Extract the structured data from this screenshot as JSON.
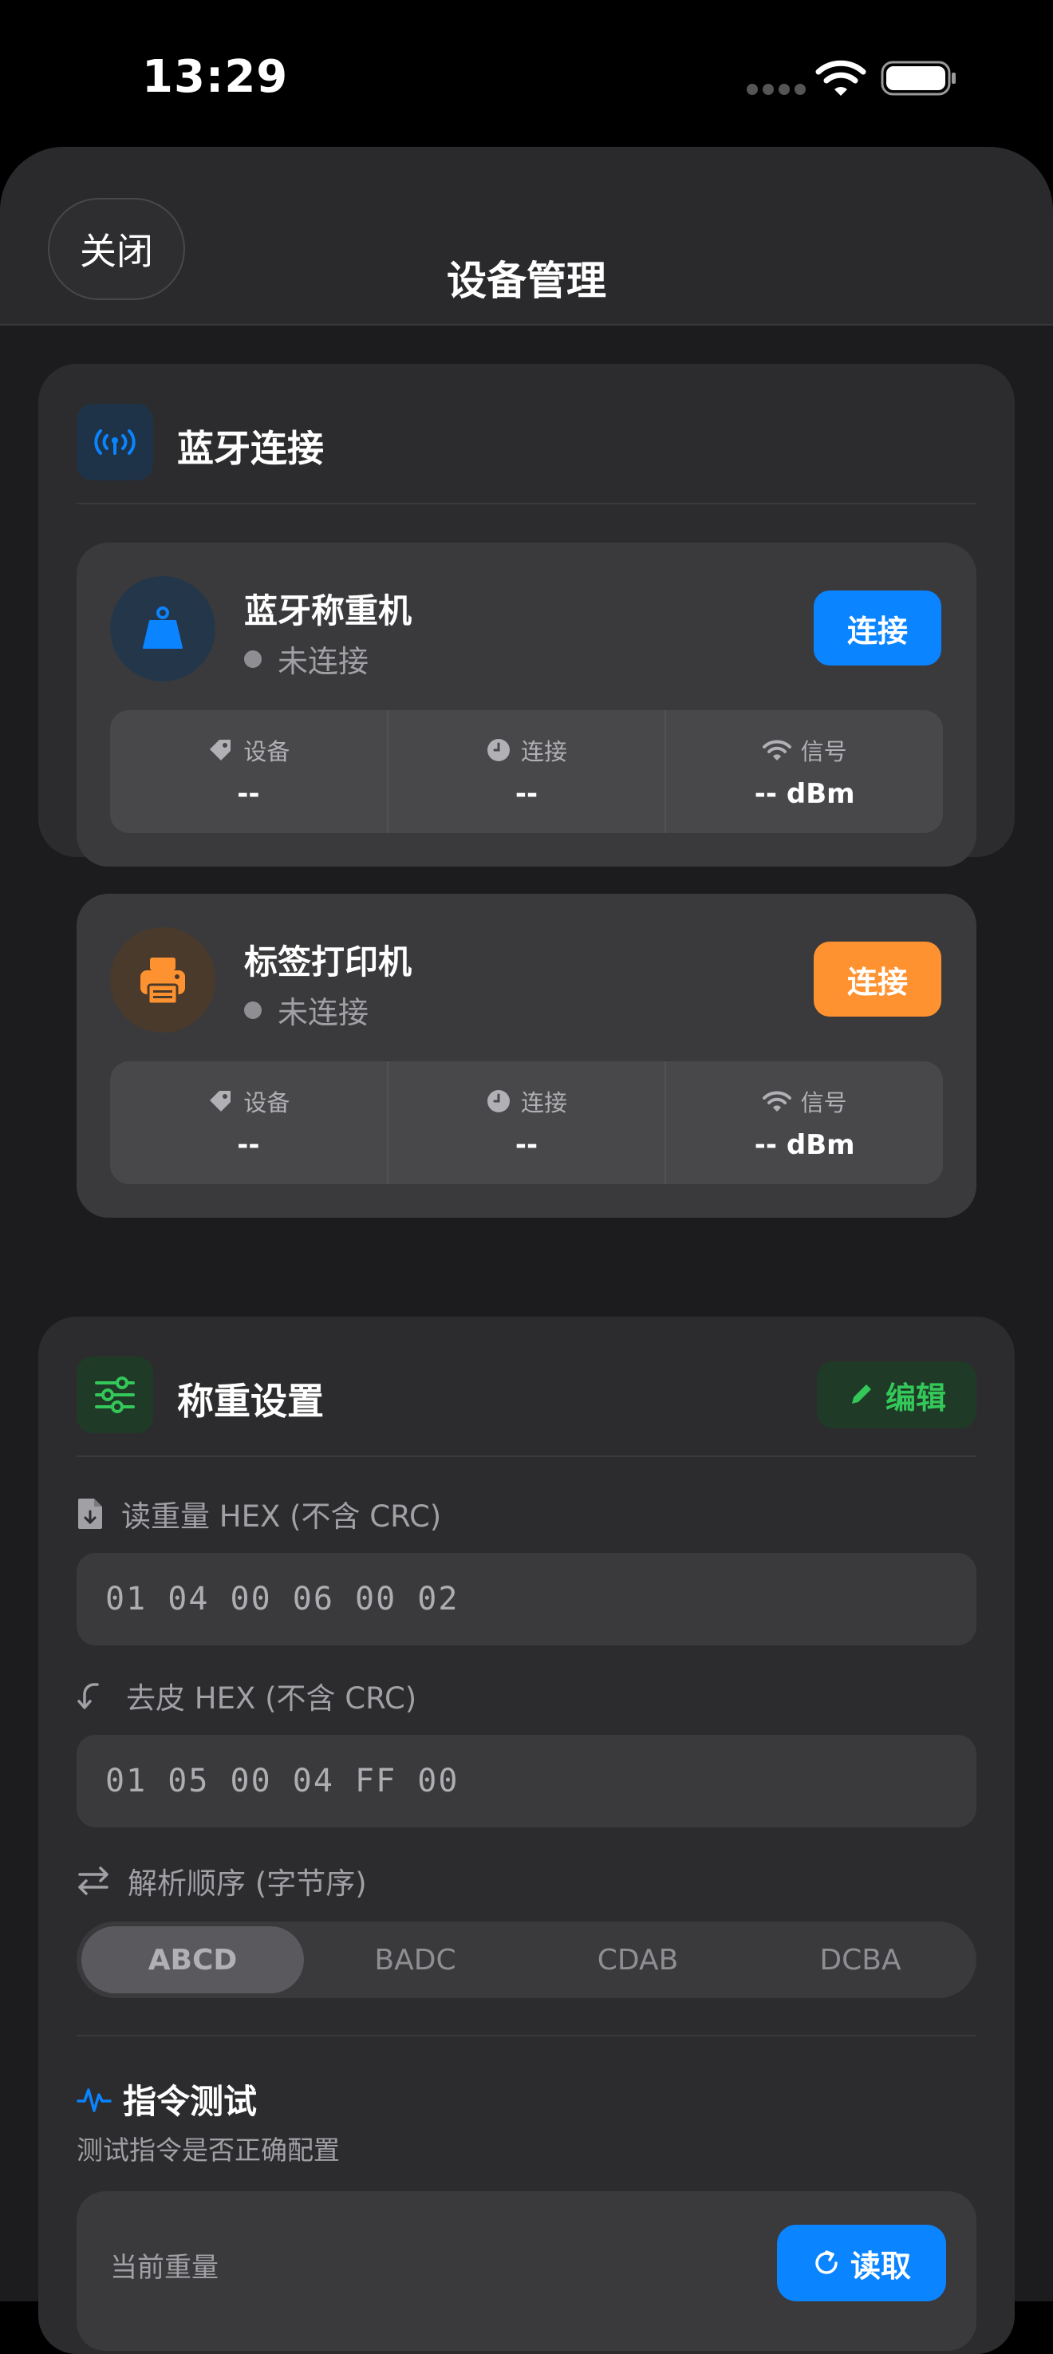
{
  "status_bar": {
    "time": "13:29"
  },
  "header": {
    "close_label": "关闭",
    "title": "设备管理"
  },
  "bluetooth": {
    "title": "蓝牙连接",
    "devices": [
      {
        "name": "蓝牙称重机",
        "status": "未连接",
        "connect_label": "连接",
        "accent": "#0a84ff",
        "icon": "scale-weight-icon",
        "stats": [
          {
            "label": "设备",
            "value": "--",
            "icon": "tag-icon"
          },
          {
            "label": "连接",
            "value": "--",
            "icon": "clock-icon"
          },
          {
            "label": "信号",
            "value": "-- dBm",
            "icon": "wifi-icon"
          }
        ]
      },
      {
        "name": "标签打印机",
        "status": "未连接",
        "connect_label": "连接",
        "accent": "#ff9230",
        "icon": "printer-icon",
        "stats": [
          {
            "label": "设备",
            "value": "--",
            "icon": "tag-icon"
          },
          {
            "label": "连接",
            "value": "--",
            "icon": "clock-icon"
          },
          {
            "label": "信号",
            "value": "-- dBm",
            "icon": "wifi-icon"
          }
        ]
      }
    ]
  },
  "weigh_settings": {
    "title": "称重设置",
    "edit_label": "编辑",
    "read_weight": {
      "label": "读重量 HEX (不含 CRC)",
      "value": "01 04 00 06 00 02"
    },
    "tare": {
      "label": "去皮 HEX (不含 CRC)",
      "value": "01 05 00 04 FF 00"
    },
    "byte_order": {
      "label": "解析顺序 (字节序)",
      "options": [
        "ABCD",
        "BADC",
        "CDAB",
        "DCBA"
      ],
      "selected": "ABCD"
    },
    "test": {
      "title": "指令测试",
      "subtitle": "测试指令是否正确配置",
      "current_weight_label": "当前重量",
      "read_label": "读取"
    }
  }
}
